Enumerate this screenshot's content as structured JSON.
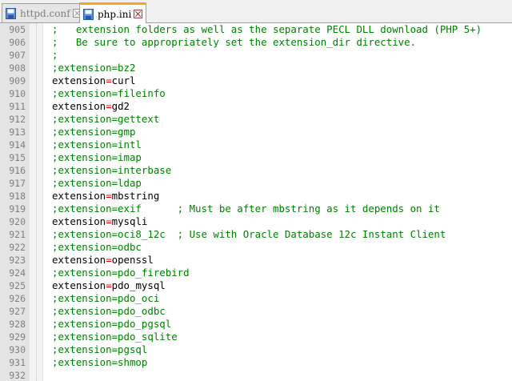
{
  "tabs": [
    {
      "label": "httpd.conf",
      "active": false
    },
    {
      "label": "php.ini",
      "active": true
    }
  ],
  "colors": {
    "comment": "#008000",
    "key": "#000000",
    "operator": "#ff0000",
    "active_tab_accent": "#f5a623"
  },
  "lines": [
    {
      "num": "905",
      "type": "comment",
      "text": ";   extension folders as well as the separate PECL DLL download (PHP 5+)"
    },
    {
      "num": "906",
      "type": "comment",
      "text": ";   Be sure to appropriately set the extension_dir directive."
    },
    {
      "num": "907",
      "type": "comment",
      "text": ";"
    },
    {
      "num": "908",
      "type": "comment",
      "text": ";extension=bz2"
    },
    {
      "num": "909",
      "type": "setting",
      "key": "extension",
      "op": "=",
      "value": "curl"
    },
    {
      "num": "910",
      "type": "comment",
      "text": ";extension=fileinfo"
    },
    {
      "num": "911",
      "type": "setting",
      "key": "extension",
      "op": "=",
      "value": "gd2"
    },
    {
      "num": "912",
      "type": "comment",
      "text": ";extension=gettext"
    },
    {
      "num": "913",
      "type": "comment",
      "text": ";extension=gmp"
    },
    {
      "num": "914",
      "type": "comment",
      "text": ";extension=intl"
    },
    {
      "num": "915",
      "type": "comment",
      "text": ";extension=imap"
    },
    {
      "num": "916",
      "type": "comment",
      "text": ";extension=interbase"
    },
    {
      "num": "917",
      "type": "comment",
      "text": ";extension=ldap"
    },
    {
      "num": "918",
      "type": "setting",
      "key": "extension",
      "op": "=",
      "value": "mbstring"
    },
    {
      "num": "919",
      "type": "comment",
      "text": ";extension=exif      ; Must be after mbstring as it depends on it"
    },
    {
      "num": "920",
      "type": "setting",
      "key": "extension",
      "op": "=",
      "value": "mysqli"
    },
    {
      "num": "921",
      "type": "comment",
      "text": ";extension=oci8_12c  ; Use with Oracle Database 12c Instant Client"
    },
    {
      "num": "922",
      "type": "comment",
      "text": ";extension=odbc"
    },
    {
      "num": "923",
      "type": "setting",
      "key": "extension",
      "op": "=",
      "value": "openssl"
    },
    {
      "num": "924",
      "type": "comment",
      "text": ";extension=pdo_firebird"
    },
    {
      "num": "925",
      "type": "setting",
      "key": "extension",
      "op": "=",
      "value": "pdo_mysql"
    },
    {
      "num": "926",
      "type": "comment",
      "text": ";extension=pdo_oci"
    },
    {
      "num": "927",
      "type": "comment",
      "text": ";extension=pdo_odbc"
    },
    {
      "num": "928",
      "type": "comment",
      "text": ";extension=pdo_pgsql"
    },
    {
      "num": "929",
      "type": "comment",
      "text": ";extension=pdo_sqlite"
    },
    {
      "num": "930",
      "type": "comment",
      "text": ";extension=pgsql"
    },
    {
      "num": "931",
      "type": "comment",
      "text": ";extension=shmop"
    },
    {
      "num": "932",
      "type": "empty"
    }
  ]
}
